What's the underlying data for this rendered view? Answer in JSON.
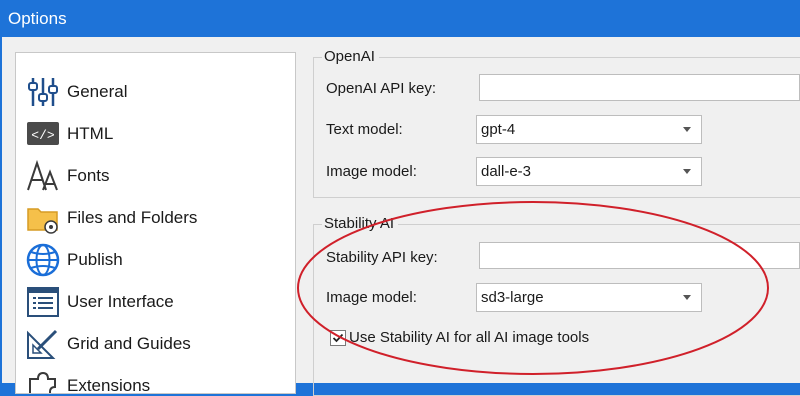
{
  "window": {
    "title": "Options"
  },
  "sidebar": {
    "items": [
      {
        "label": "General",
        "icon": "sliders-icon"
      },
      {
        "label": "HTML",
        "icon": "code-icon"
      },
      {
        "label": "Fonts",
        "icon": "fonts-icon"
      },
      {
        "label": "Files and Folders",
        "icon": "folder-gear-icon"
      },
      {
        "label": "Publish",
        "icon": "globe-icon"
      },
      {
        "label": "User Interface",
        "icon": "window-list-icon"
      },
      {
        "label": "Grid and Guides",
        "icon": "ruler-pencil-icon"
      },
      {
        "label": "Extensions",
        "icon": "puzzle-icon"
      }
    ]
  },
  "openai": {
    "group_title": "OpenAI",
    "api_key_label": "OpenAI API key:",
    "api_key_value": "",
    "text_model_label": "Text model:",
    "text_model_value": "gpt-4",
    "image_model_label": "Image model:",
    "image_model_value": "dall-e-3"
  },
  "stability": {
    "group_title": "Stability AI",
    "api_key_label": "Stability API key:",
    "api_key_value": "",
    "image_model_label": "Image model:",
    "image_model_value": "sd3-large",
    "checkbox_label": "Use Stability AI for all AI image tools",
    "checkbox_checked": true
  },
  "annotation": {
    "color": "#d0202a"
  }
}
